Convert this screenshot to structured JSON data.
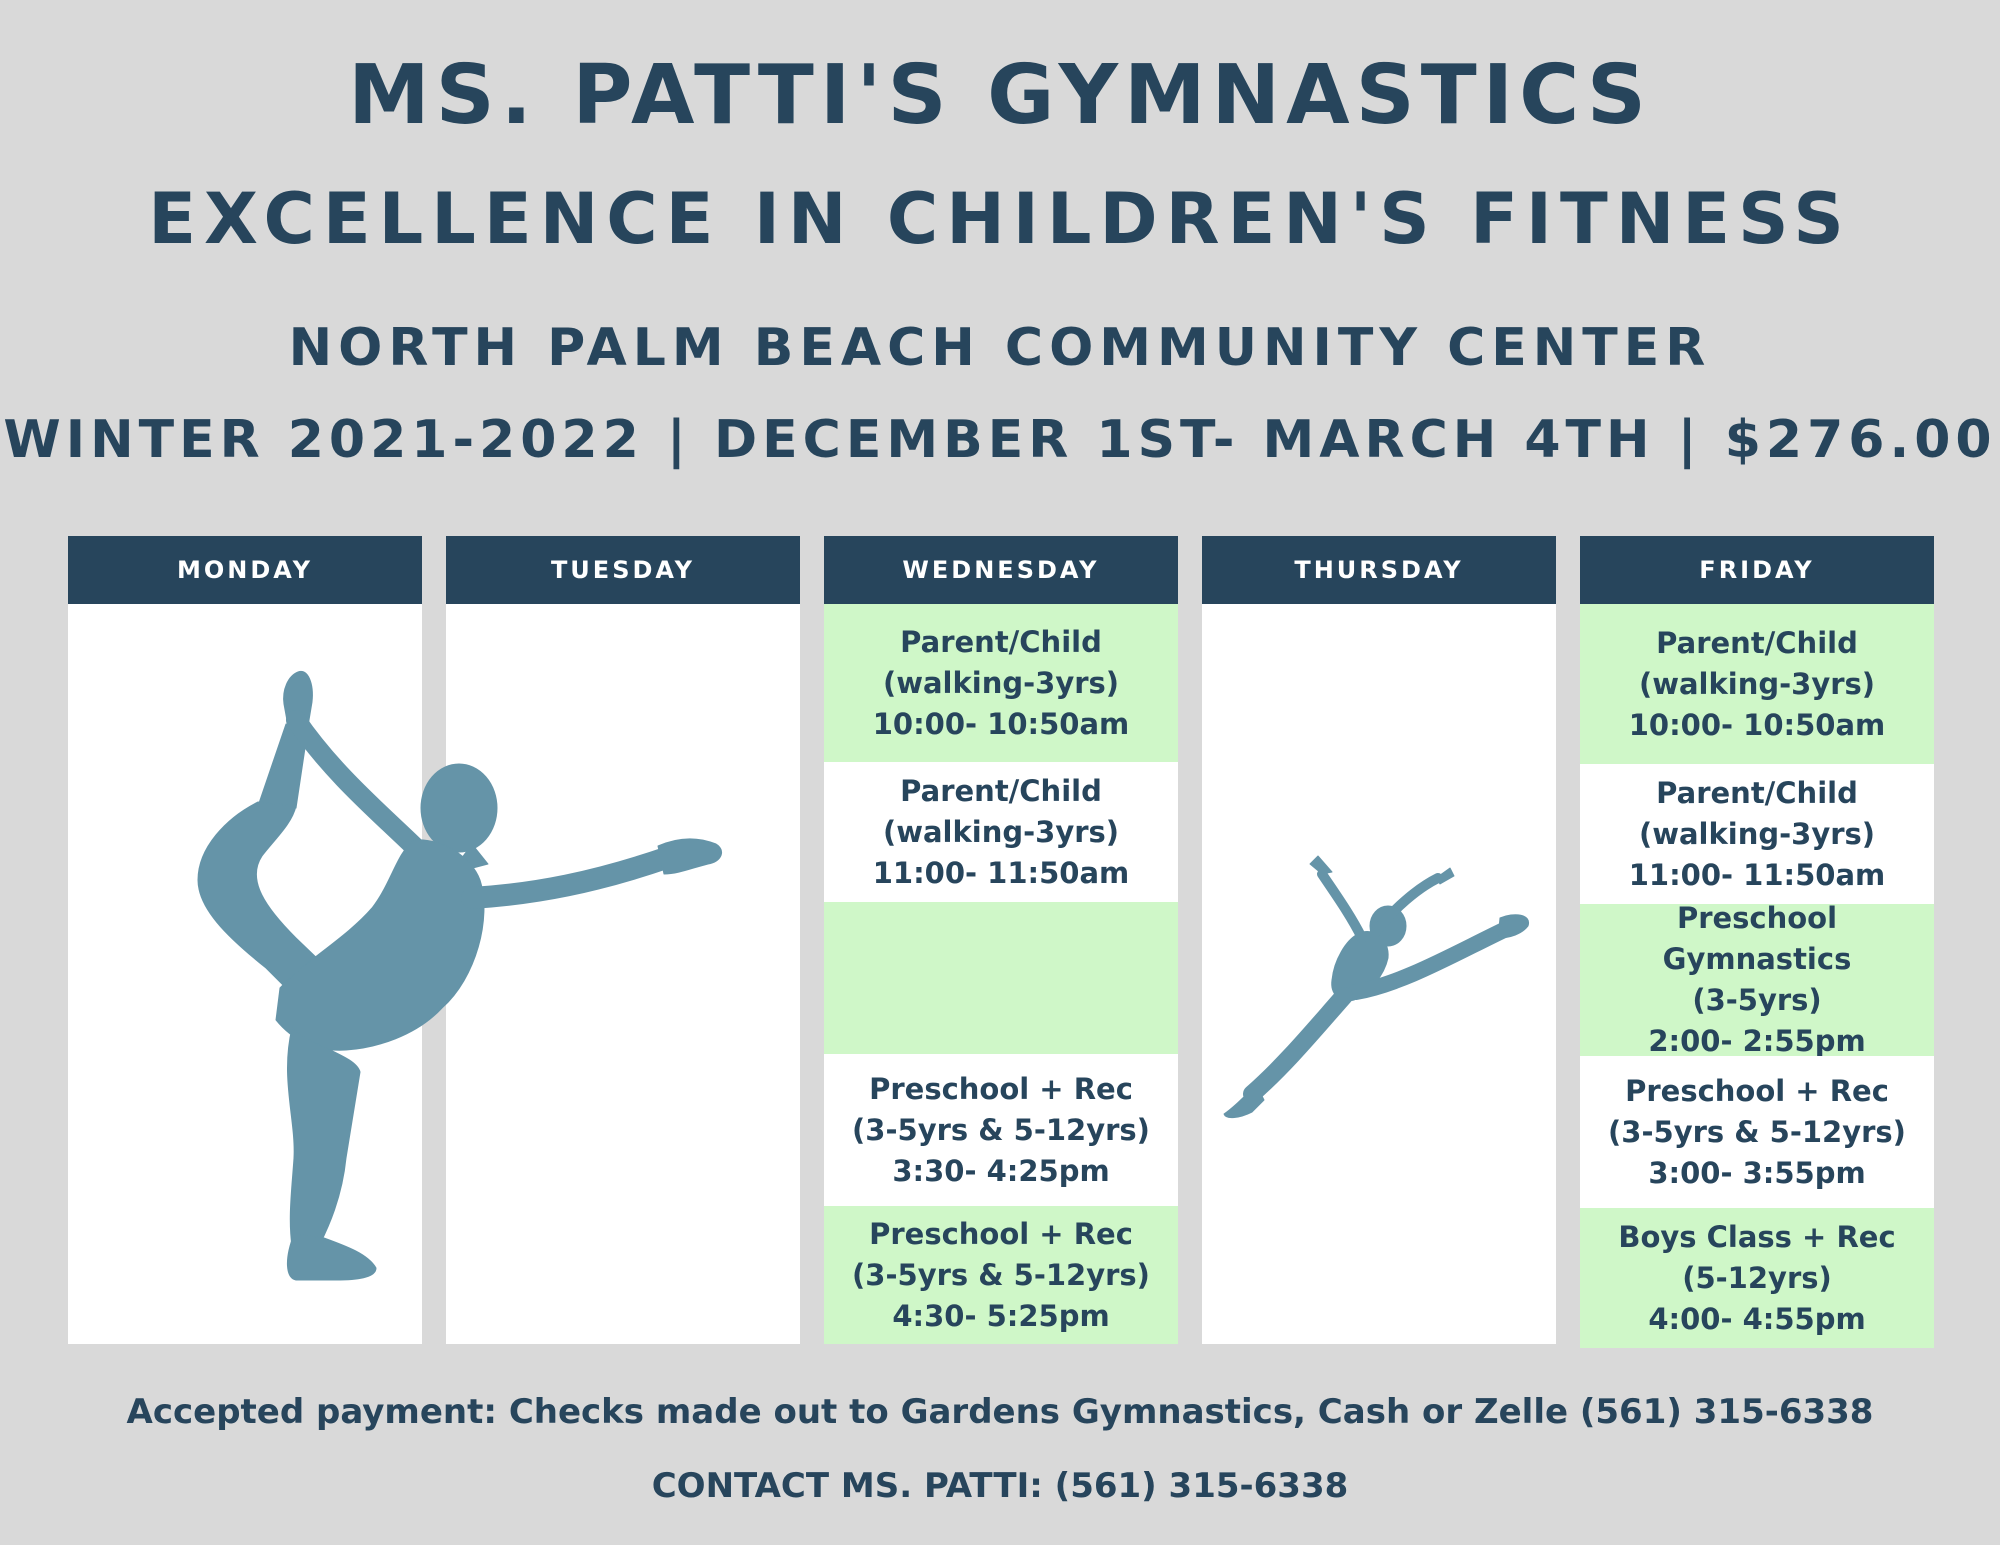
{
  "header": {
    "title": "MS. PATTI'S GYMNASTICS",
    "subtitle": "EXCELLENCE IN CHILDREN'S FITNESS",
    "location": "NORTH PALM BEACH COMMUNITY CENTER",
    "session": "WINTER 2021-2022 | DECEMBER 1ST- MARCH 4TH | $276.00"
  },
  "schedule": {
    "monday": {
      "label": "MONDAY"
    },
    "tuesday": {
      "label": "TUESDAY"
    },
    "wednesday": {
      "label": "WEDNESDAY",
      "slots": [
        {
          "name": "Parent/Child",
          "ages": "(walking-3yrs)",
          "time": "10:00- 10:50am"
        },
        {
          "name": "Parent/Child",
          "ages": "(walking-3yrs)",
          "time": "11:00- 11:50am"
        },
        {
          "name": "Preschool + Rec",
          "ages": "(3-5yrs & 5-12yrs)",
          "time": "3:30- 4:25pm"
        },
        {
          "name": "Preschool + Rec",
          "ages": "(3-5yrs & 5-12yrs)",
          "time": "4:30- 5:25pm"
        }
      ]
    },
    "thursday": {
      "label": "THURSDAY"
    },
    "friday": {
      "label": "FRIDAY",
      "slots": [
        {
          "name": "Parent/Child",
          "ages": "(walking-3yrs)",
          "time": "10:00- 10:50am"
        },
        {
          "name": "Parent/Child",
          "ages": "(walking-3yrs)",
          "time": "11:00- 11:50am"
        },
        {
          "name": "Preschool Gymnastics",
          "ages": "(3-5yrs)",
          "time": "2:00- 2:55pm"
        },
        {
          "name": "Preschool + Rec",
          "ages": "(3-5yrs & 5-12yrs)",
          "time": "3:00- 3:55pm"
        },
        {
          "name": "Boys Class + Rec",
          "ages": "(5-12yrs)",
          "time": "4:00- 4:55pm"
        }
      ]
    }
  },
  "footer": {
    "payment": "Accepted payment: Checks made out to Gardens Gymnastics, Cash or Zelle (561) 315-6338",
    "contact": "CONTACT MS. PATTI: (561) 315-6338"
  },
  "colors": {
    "navy": "#27455c",
    "green_slot": "#cff7c8",
    "silhouette": "#6594a8",
    "background": "#d9d9d9"
  }
}
